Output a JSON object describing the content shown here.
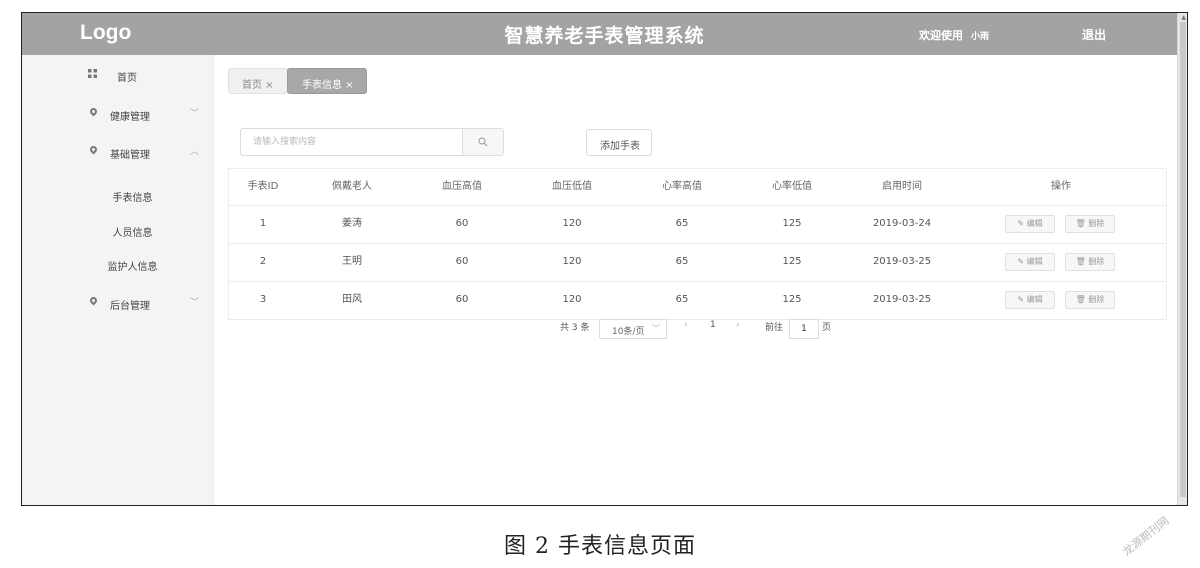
{
  "header": {
    "logo": "Logo",
    "title": "智慧养老手表管理系统",
    "welcome": "欢迎使用",
    "user": "小雨",
    "logout": "退出"
  },
  "sidebar": {
    "items": [
      {
        "label": "首页",
        "icon": "grid-icon"
      },
      {
        "label": "健康管理",
        "icon": "location-pin-icon",
        "arrow": "﹀"
      },
      {
        "label": "基础管理",
        "icon": "location-pin-icon",
        "arrow": "︿"
      },
      {
        "label": "后台管理",
        "icon": "location-pin-icon",
        "arrow": "﹀"
      }
    ],
    "subitems": [
      {
        "label": "手表信息"
      },
      {
        "label": "人员信息"
      },
      {
        "label": "监护人信息"
      }
    ]
  },
  "tabs": [
    {
      "label": "首页 ×"
    },
    {
      "label": "手表信息 ×"
    }
  ],
  "search": {
    "placeholder": "请输入搜索内容",
    "add_label": "添加手表"
  },
  "table": {
    "columns": [
      "手表ID",
      "佩戴老人",
      "血压高值",
      "血压低值",
      "心率高值",
      "心率低值",
      "启用时间",
      "操作"
    ],
    "rows": [
      [
        "1",
        "姜涛",
        "60",
        "120",
        "65",
        "125",
        "2019-03-24"
      ],
      [
        "2",
        "王明",
        "60",
        "120",
        "65",
        "125",
        "2019-03-25"
      ],
      [
        "3",
        "田风",
        "60",
        "120",
        "65",
        "125",
        "2019-03-25"
      ]
    ],
    "edit_label": "✎ 编辑",
    "delete_label": "🗑 删除"
  },
  "pagination": {
    "total": "共 3 条",
    "page_size": "10条/页",
    "prev": "‹",
    "current": "1",
    "next": "›",
    "goto_label": "前往",
    "goto_value": "1",
    "page_suffix": "页"
  },
  "caption": "图 2   手表信息页面",
  "watermark": "龙源期刊网"
}
